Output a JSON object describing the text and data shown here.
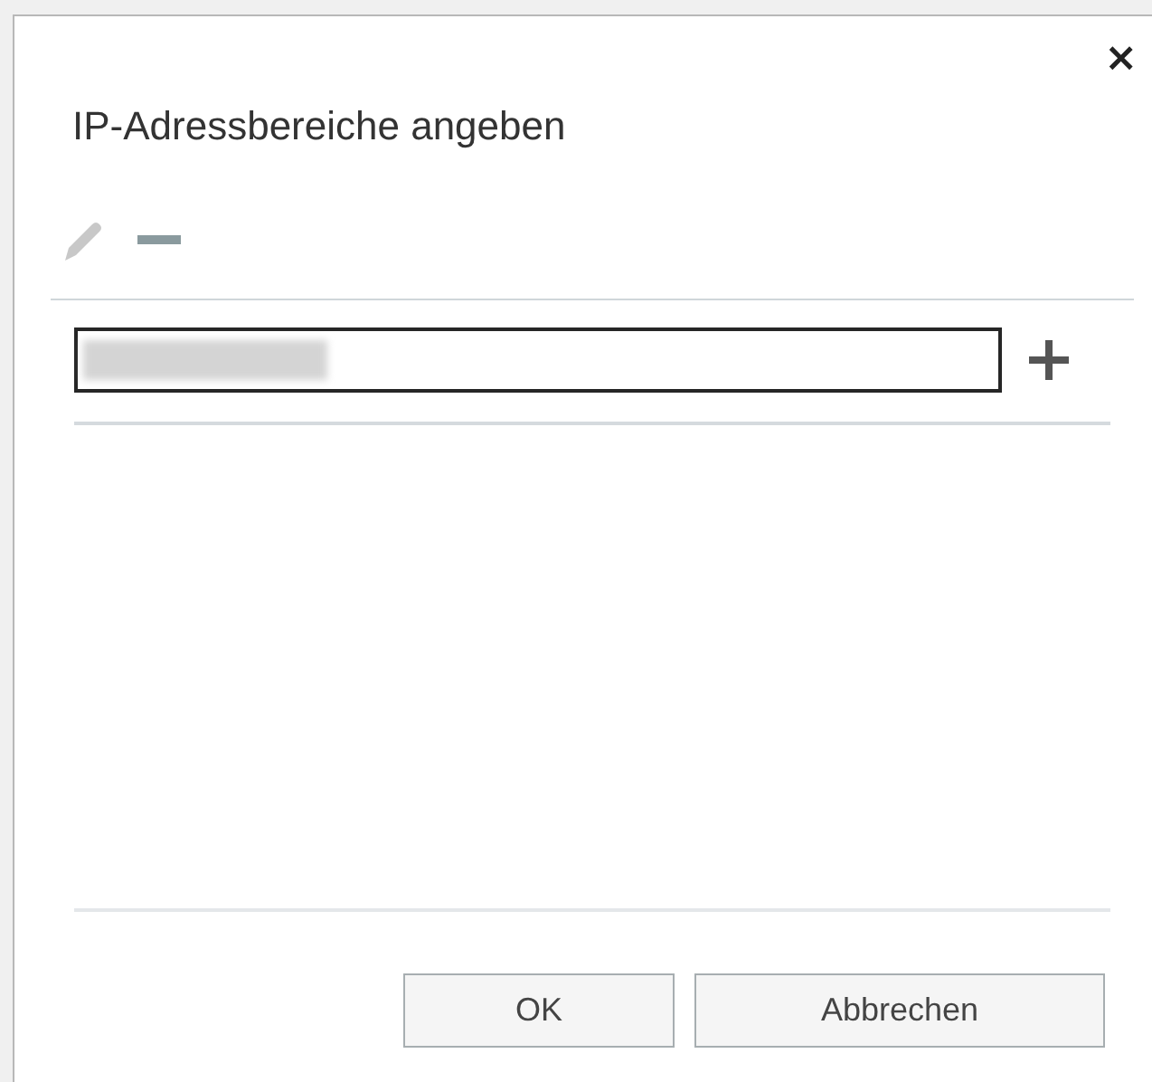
{
  "dialog": {
    "title": "IP-Adressbereiche angeben",
    "close": "×"
  },
  "toolbar": [
    {
      "kind": "edit",
      "disabled": true
    },
    {
      "kind": "remove",
      "disabled": false
    }
  ],
  "input": {
    "has_redacted_value": true
  },
  "buttons": [
    "OK",
    "Abbrechen"
  ]
}
